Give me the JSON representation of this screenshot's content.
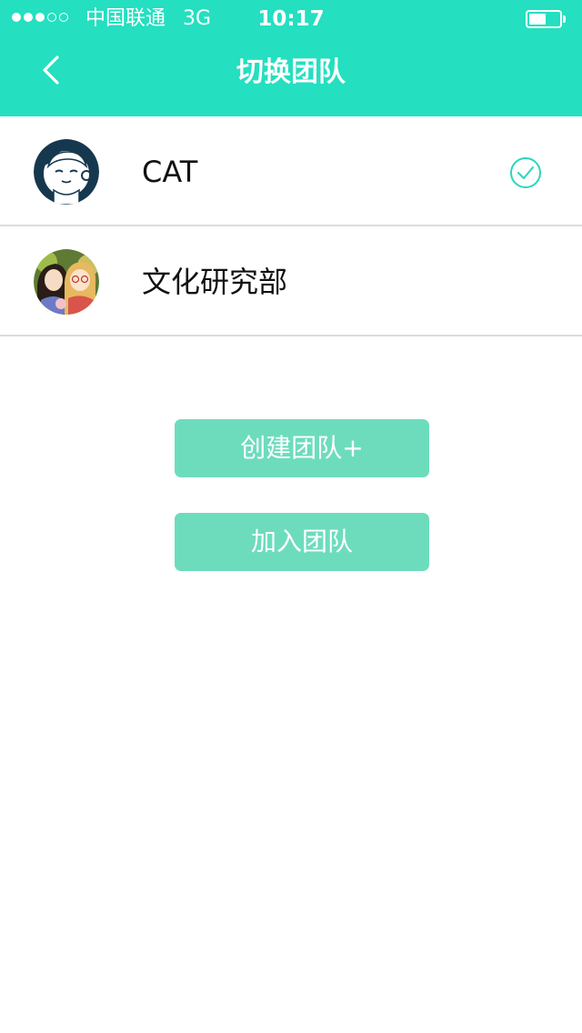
{
  "status_bar": {
    "carrier": "中国联通",
    "network": "3G",
    "time": "10:17",
    "signal_strength": 3,
    "signal_max": 5,
    "battery_level": 0.55
  },
  "nav": {
    "title": "切换团队",
    "back_icon": "chevron-left-icon"
  },
  "teams": [
    {
      "name": "CAT",
      "selected": true
    },
    {
      "name": "文化研究部",
      "selected": false
    }
  ],
  "actions": {
    "create_label": "创建团队+",
    "join_label": "加入团队"
  },
  "colors": {
    "accent": "#24dfc0",
    "button": "#6ddcbd",
    "check": "#2ad6bc",
    "divider": "#dcdcdc"
  }
}
